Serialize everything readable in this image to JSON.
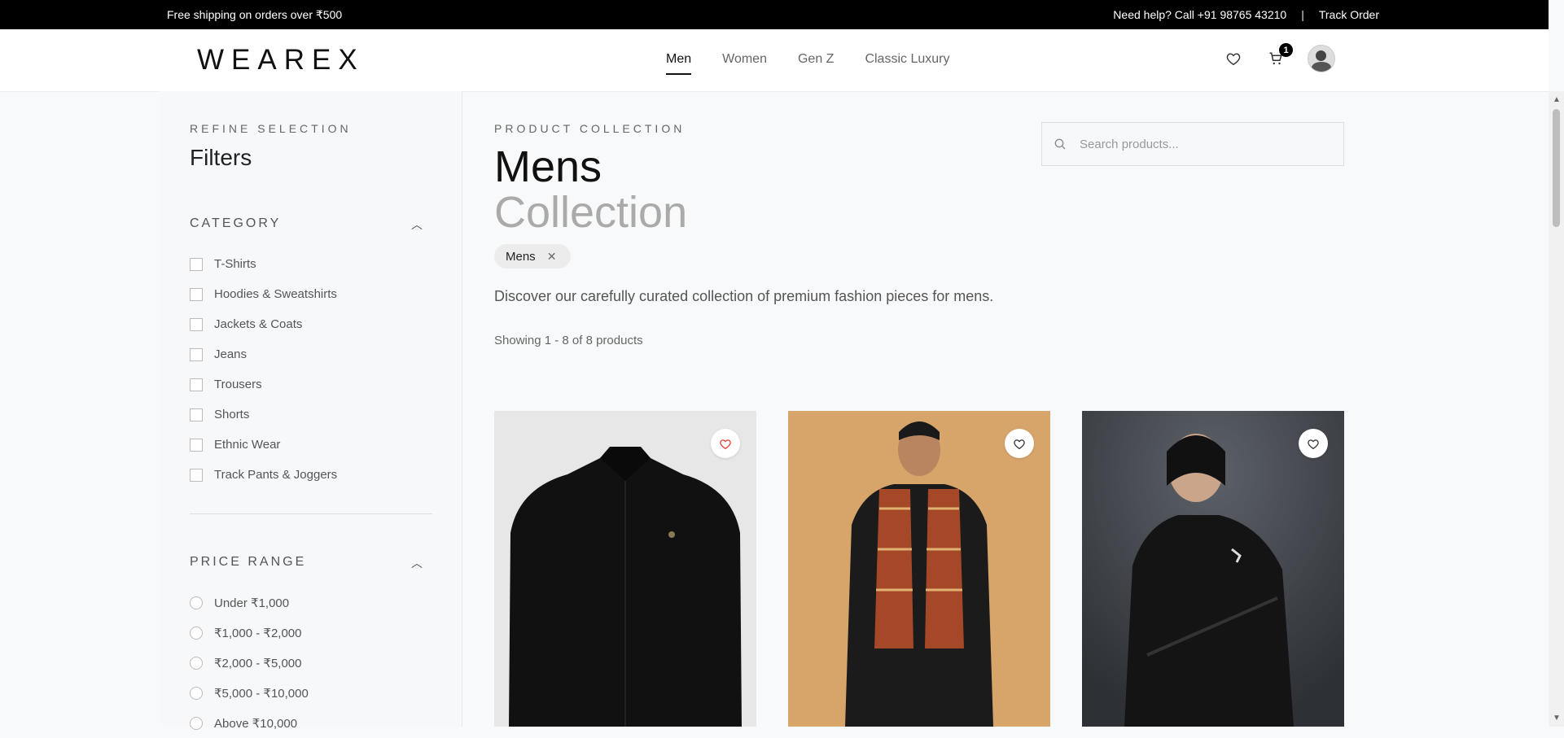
{
  "topbar": {
    "shipping": "Free shipping on orders over ₹500",
    "help": "Need help? Call +91 98765 43210",
    "separator": "|",
    "track": "Track Order"
  },
  "header": {
    "logo": "WEAREX",
    "nav": [
      "Men",
      "Women",
      "Gen Z",
      "Classic Luxury"
    ],
    "active_nav": "Men",
    "cart_count": "1",
    "icons": [
      "heart-icon",
      "cart-icon",
      "avatar"
    ]
  },
  "sidebar": {
    "eyebrow": "REFINE SELECTION",
    "title": "Filters",
    "category": {
      "title": "CATEGORY",
      "options": [
        "T-Shirts",
        "Hoodies & Sweatshirts",
        "Jackets & Coats",
        "Jeans",
        "Trousers",
        "Shorts",
        "Ethnic Wear",
        "Track Pants & Joggers"
      ]
    },
    "price": {
      "title": "PRICE RANGE",
      "options": [
        "Under ₹1,000",
        "₹1,000 - ₹2,000",
        "₹2,000 - ₹5,000",
        "₹5,000 - ₹10,000",
        "Above ₹10,000"
      ]
    }
  },
  "main": {
    "eyebrow": "PRODUCT COLLECTION",
    "title_line1": "Mens",
    "title_line2": "Collection",
    "chip": "Mens",
    "chip_close": "✕",
    "description": "Discover our carefully curated collection of premium fashion pieces for mens.",
    "count": "Showing 1 - 8 of 8 products",
    "search_placeholder": "Search products..."
  },
  "colors": {
    "accent": "#000000",
    "wish_active": "#e53935",
    "card1_bg": "#e7e7e7",
    "card2_bg": "#d7a56a",
    "card3_bg": "#4a4e55"
  }
}
